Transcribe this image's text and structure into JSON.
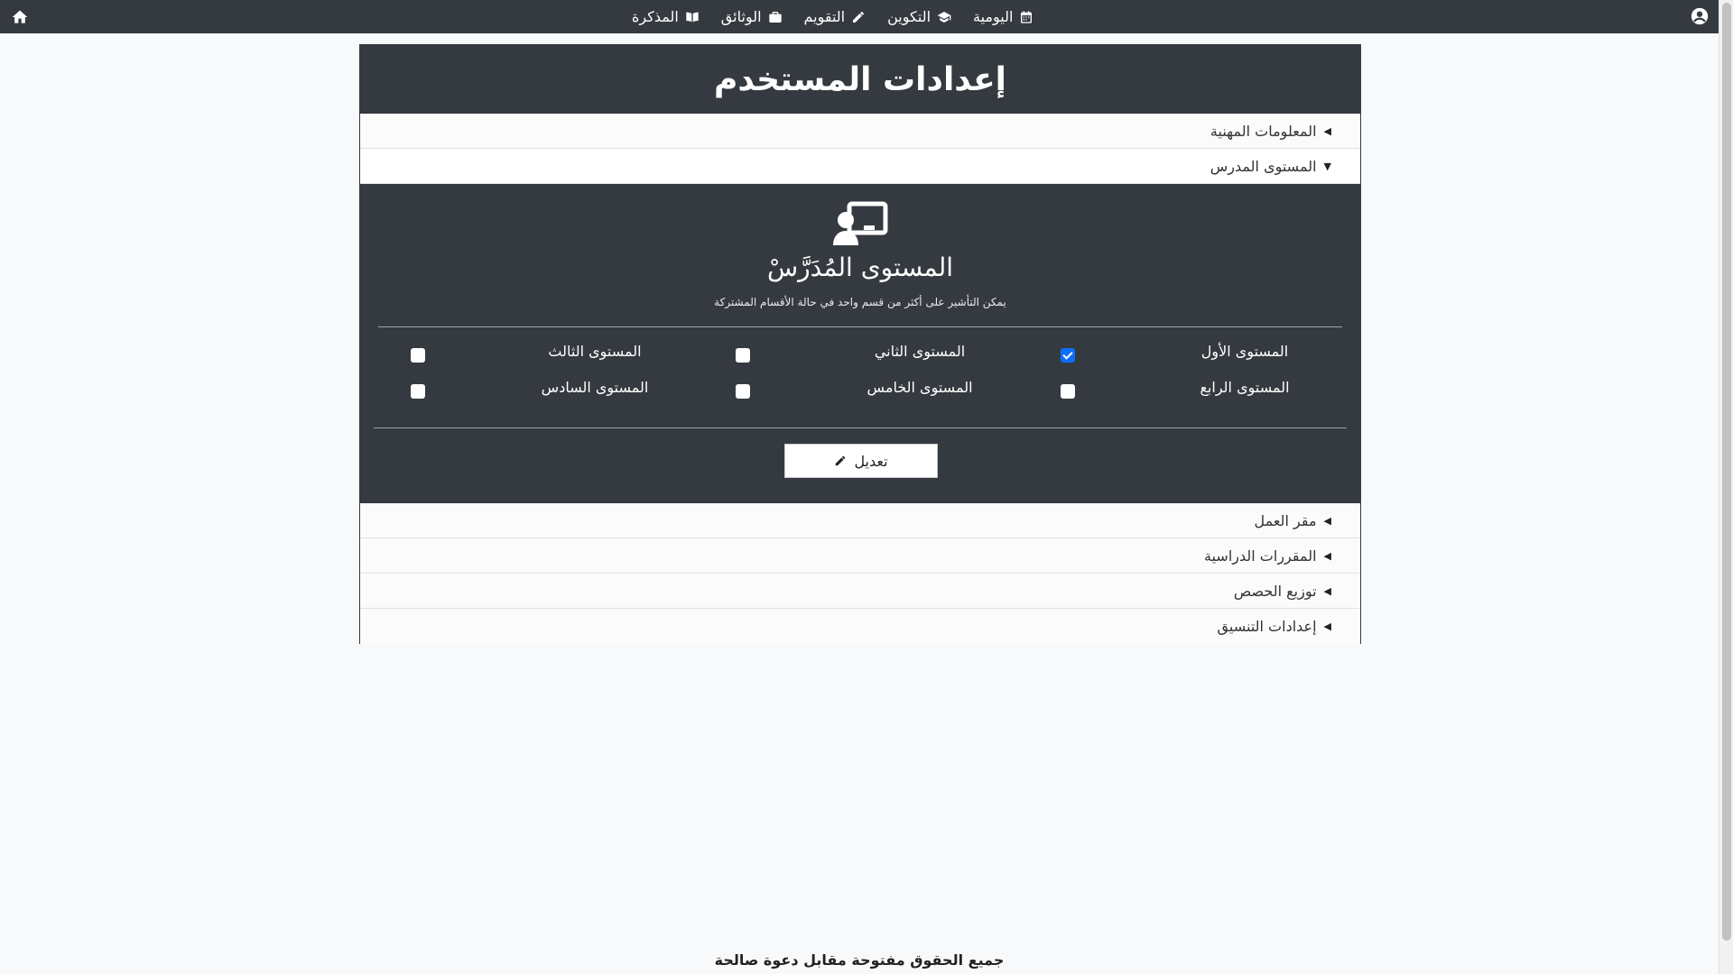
{
  "navbar": {
    "links": [
      {
        "label": "المذكرة",
        "icon": "book-open-icon"
      },
      {
        "label": "الوثائق",
        "icon": "briefcase-icon"
      },
      {
        "label": "التقويم",
        "icon": "pencil-icon"
      },
      {
        "label": "التكوين",
        "icon": "graduation-cap-icon"
      },
      {
        "label": "اليومية",
        "icon": "calendar-icon"
      }
    ],
    "home_icon": "home-icon",
    "user_icon": "user-circle-icon"
  },
  "card": {
    "title": "إعدادات المستخدم",
    "sections_top": [
      {
        "label": "المعلومات المهنية",
        "state": "collapsed"
      },
      {
        "label": "المستوى المدرس",
        "state": "expanded"
      }
    ],
    "panel": {
      "icon": "chalkboard-teacher-icon",
      "title": "المستوى المُدَرَّسْ",
      "note": "يمكن التأشير على أكثر من قسم واحد في حالة الأقسام المشتركة",
      "levels": [
        {
          "label": "المستوى الأول",
          "checked": true
        },
        {
          "label": "المستوى الثاني",
          "checked": false
        },
        {
          "label": "المستوى الثالث",
          "checked": false
        },
        {
          "label": "المستوى الرابع",
          "checked": false
        },
        {
          "label": "المستوى الخامس",
          "checked": false
        },
        {
          "label": "المستوى السادس",
          "checked": false
        }
      ],
      "edit_label": "تعديل"
    },
    "sections_bottom": [
      {
        "label": "مقر العمل"
      },
      {
        "label": "المقررات الدراسية"
      },
      {
        "label": "توزيع الحصص"
      },
      {
        "label": "إعدادات التنسيق"
      }
    ]
  },
  "footer": "جميع الحقوق مفتوحة مقابل دعوة صالحة",
  "colors": {
    "dark": "#343a40",
    "check_blue": "#0d6efd",
    "page_bg": "#f8f9fa"
  }
}
